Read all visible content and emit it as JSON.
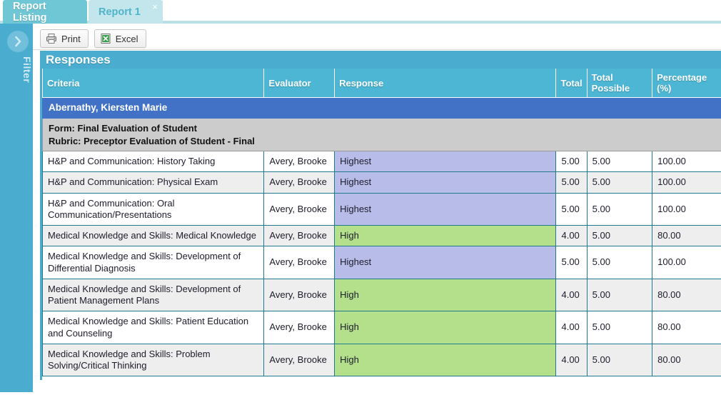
{
  "tabs": [
    {
      "label": "Report Listing",
      "active": false
    },
    {
      "label": "Report 1",
      "active": true,
      "close": "×"
    }
  ],
  "filter_panel": {
    "label": "Filter",
    "toggle_icon": "chevron-right-icon"
  },
  "toolbar": {
    "print_label": "Print",
    "print_icon": "printer-icon",
    "excel_label": "Excel",
    "excel_icon": "excel-spreadsheet-icon"
  },
  "section": {
    "title": "Responses"
  },
  "table": {
    "columns": [
      "Criteria",
      "Evaluator",
      "Response",
      "Total",
      "Total Possible",
      "Percentage (%)"
    ],
    "student_name": "Abernathy, Kiersten Marie",
    "form_line": "Form: Final Evaluation of Student",
    "rubric_line": "Rubric: Preceptor Evaluation of Student - Final",
    "rows": [
      {
        "criteria": "H&P and Communication: History Taking",
        "evaluator": "Avery, Brooke",
        "response": "Highest",
        "response_level": "highest",
        "total": "5.00",
        "total_possible": "5.00",
        "percentage": "100.00"
      },
      {
        "criteria": "H&P and Communication: Physical Exam",
        "evaluator": "Avery, Brooke",
        "response": "Highest",
        "response_level": "highest",
        "total": "5.00",
        "total_possible": "5.00",
        "percentage": "100.00"
      },
      {
        "criteria": "H&P and Communication: Oral Communication/Presentations",
        "evaluator": "Avery, Brooke",
        "response": "Highest",
        "response_level": "highest",
        "total": "5.00",
        "total_possible": "5.00",
        "percentage": "100.00"
      },
      {
        "criteria": "Medical Knowledge and Skills: Medical Knowledge",
        "evaluator": "Avery, Brooke",
        "response": "High",
        "response_level": "high",
        "total": "4.00",
        "total_possible": "5.00",
        "percentage": "80.00"
      },
      {
        "criteria": "Medical Knowledge and Skills: Development of Differential Diagnosis",
        "evaluator": "Avery, Brooke",
        "response": "Highest",
        "response_level": "highest",
        "total": "5.00",
        "total_possible": "5.00",
        "percentage": "100.00"
      },
      {
        "criteria": "Medical Knowledge and Skills: Development of Patient Management Plans",
        "evaluator": "Avery, Brooke",
        "response": "High",
        "response_level": "high",
        "total": "4.00",
        "total_possible": "5.00",
        "percentage": "80.00"
      },
      {
        "criteria": "Medical Knowledge and Skills: Patient Education and Counseling",
        "evaluator": "Avery, Brooke",
        "response": "High",
        "response_level": "high",
        "total": "4.00",
        "total_possible": "5.00",
        "percentage": "80.00"
      },
      {
        "criteria": "Medical Knowledge and Skills: Problem Solving/Critical Thinking",
        "evaluator": "Avery, Brooke",
        "response": "High",
        "response_level": "high",
        "total": "4.00",
        "total_possible": "5.00",
        "percentage": "80.00"
      }
    ]
  },
  "colors": {
    "accent_cyan": "#4aadd0",
    "header_cyan": "#4cb6d4",
    "name_blue": "#4272c6",
    "tab_active": "#c3e6ec",
    "tab_inactive": "#6fc7d6",
    "response_highest": "#b8bce8",
    "response_high": "#b4e08c",
    "form_gray": "#cccccc",
    "row_stripe": "#eeeeee"
  }
}
